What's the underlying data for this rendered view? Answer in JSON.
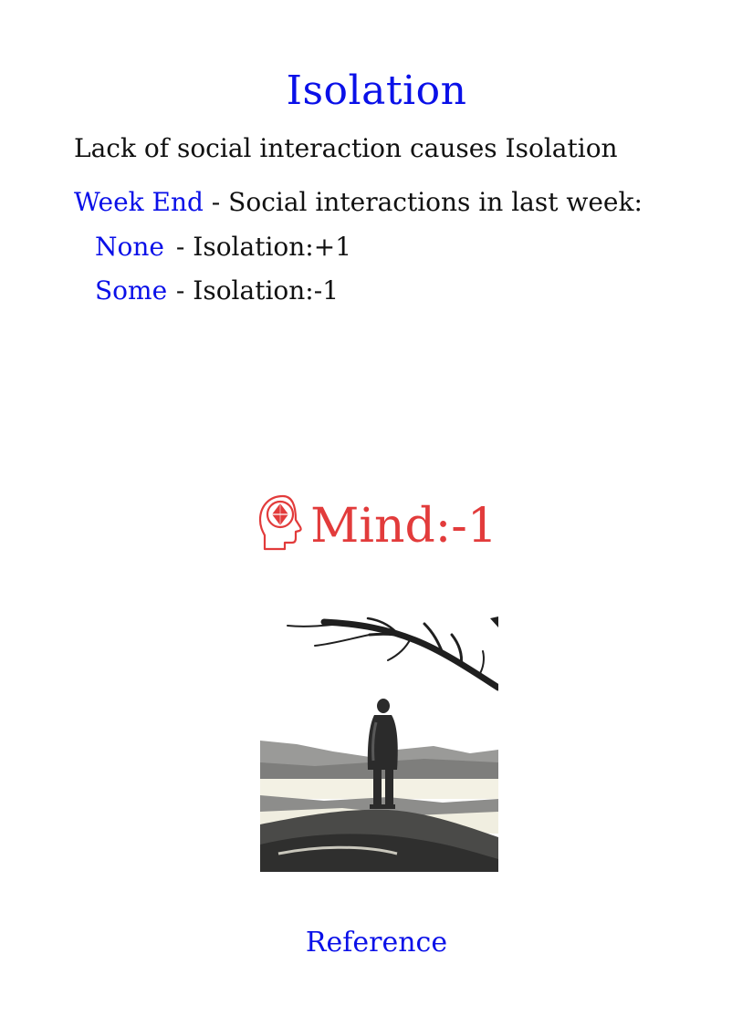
{
  "card": {
    "title": "Isolation",
    "description": "Lack of social interaction causes Isolation",
    "trigger": {
      "label": "Week End",
      "text": " - Social interactions in last week:"
    },
    "options": [
      {
        "label": "None",
        "effect": " - Isolation:+1"
      },
      {
        "label": "Some",
        "effect": " - Isolation:-1"
      }
    ],
    "effect": {
      "icon": "mind-head-icon",
      "text": "Mind:-1",
      "color": "#e23b3b"
    },
    "illustration": "lonely-figure-on-hill",
    "reference_link": "Reference"
  },
  "colors": {
    "link": "#0a10e8",
    "text": "#111111",
    "effect": "#e23b3b"
  }
}
